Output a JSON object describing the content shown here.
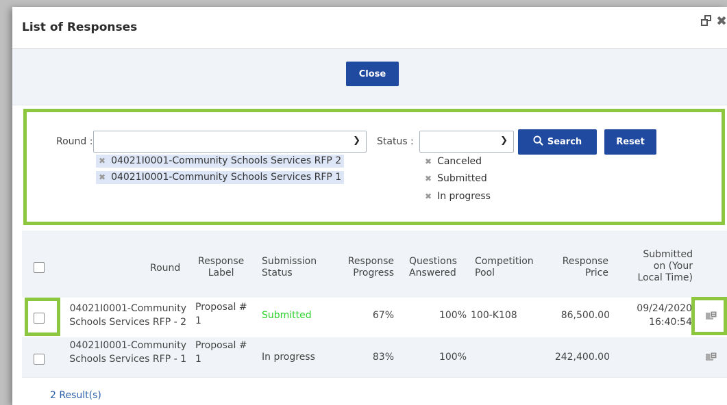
{
  "dialog": {
    "title": "List of Responses",
    "close_label": "Close"
  },
  "filters": {
    "round_label": "Round :",
    "round_selected": [
      "04021I0001-Community Schools Services RFP 2",
      "04021I0001-Community Schools Services RFP 1"
    ],
    "status_label": "Status :",
    "status_options": [
      "Canceled",
      "Submitted",
      "In progress"
    ],
    "search_label": "Search",
    "reset_label": "Reset"
  },
  "table": {
    "headers": {
      "round": "Round",
      "label_l1": "Response",
      "label_l2": "Label",
      "status_l1": "Submission",
      "status_l2": "Status",
      "progress_l1": "Response",
      "progress_l2": "Progress",
      "questions_l1": "Questions",
      "questions_l2": "Answered",
      "pool_l1": "Competition",
      "pool_l2": "Pool",
      "price_l1": "Response",
      "price_l2": "Price",
      "submitted_l1": "Submitted",
      "submitted_l2": "on (Your",
      "submitted_l3": "Local Time)"
    },
    "rows": [
      {
        "round_l1": "04021I0001-Community",
        "round_l2": "Schools Services RFP - 2",
        "label_l1": "Proposal #",
        "label_l2": "1",
        "status": "Submitted",
        "progress": "67%",
        "questions": "100%",
        "pool": "100-K108",
        "price": "86,500.00",
        "submitted_date": "09/24/2020",
        "submitted_time": "16:40:54"
      },
      {
        "round_l1": "04021I0001-Community",
        "round_l2": "Schools Services RFP - 1",
        "label_l1": "Proposal #",
        "label_l2": "1",
        "status": "In progress",
        "progress": "83%",
        "questions": "100%",
        "pool": "",
        "price": "242,400.00",
        "submitted_date": "",
        "submitted_time": ""
      }
    ],
    "results": "2 Result(s)"
  },
  "colors": {
    "accent": "#1f4aa0",
    "highlight": "#8dc63f",
    "submitted": "#2bd12b"
  }
}
